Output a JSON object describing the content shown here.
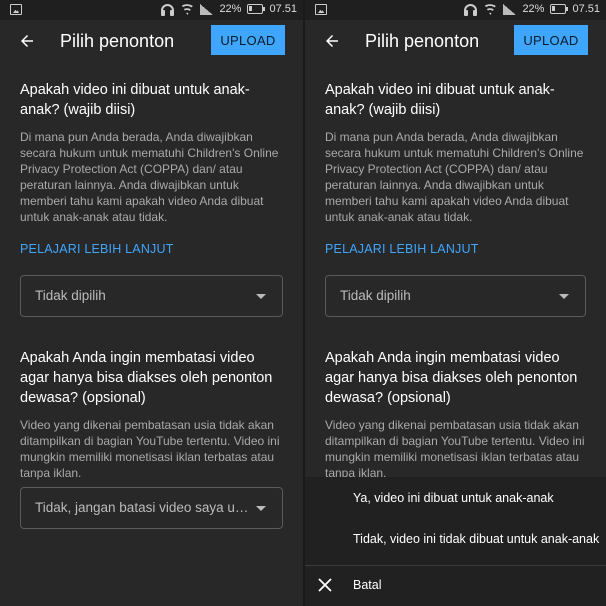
{
  "status_bar": {
    "battery_percent": "22%",
    "time": "07.51"
  },
  "app_bar": {
    "title": "Pilih penonton",
    "upload_label": "UPLOAD"
  },
  "section1": {
    "question": "Apakah video ini dibuat untuk anak-anak? (wajib diisi)",
    "description": "Di mana pun Anda berada, Anda diwajibkan secara hukum untuk mematuhi Children's Online Privacy Protection Act (COPPA) dan/ atau peraturan lainnya. Anda diwajibkan untuk memberi tahu kami apakah video Anda dibuat untuk anak-anak atau tidak.",
    "link": "PELAJARI LEBIH LANJUT",
    "dropdown_value": "Tidak dipilih"
  },
  "section2": {
    "question": "Apakah Anda ingin membatasi video agar hanya bisa diakses oleh penonton dewasa? (opsional)",
    "description": "Video yang dikenai pembatasan usia tidak akan ditampilkan di bagian YouTube tertentu. Video ini mungkin memiliki monetisasi iklan terbatas atau tanpa iklan.",
    "dropdown_value": "Tidak, jangan batasi video saya un..."
  },
  "sheet": {
    "options": [
      "Ya, video ini dibuat untuk anak-anak",
      "Tidak, video ini tidak dibuat untuk anak-anak"
    ],
    "cancel_label": "Batal"
  }
}
